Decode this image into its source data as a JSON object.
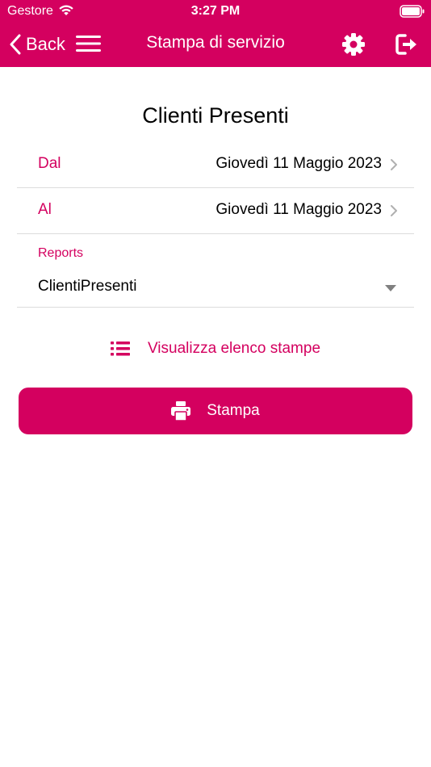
{
  "status_bar": {
    "carrier": "Gestore",
    "time": "3:27 PM"
  },
  "nav": {
    "back_label": "Back",
    "title": "Stampa di servizio",
    "icons": [
      "chevron-left-icon",
      "hamburger-menu-icon",
      "gear-icon",
      "logout-icon"
    ]
  },
  "content": {
    "heading": "Clienti Presenti",
    "date_from": {
      "label": "Dal",
      "value": "Giovedì 11 Maggio 2023"
    },
    "date_to": {
      "label": "Al",
      "value": "Giovedì 11 Maggio 2023"
    },
    "reports": {
      "label": "Reports",
      "selected": "ClientiPresenti"
    },
    "list_link": "Visualizza elenco stampe",
    "print_button": "Stampa"
  },
  "colors": {
    "brand": "#d4005f",
    "divider": "#dcdcdc",
    "chevron": "#b0b0b0"
  }
}
